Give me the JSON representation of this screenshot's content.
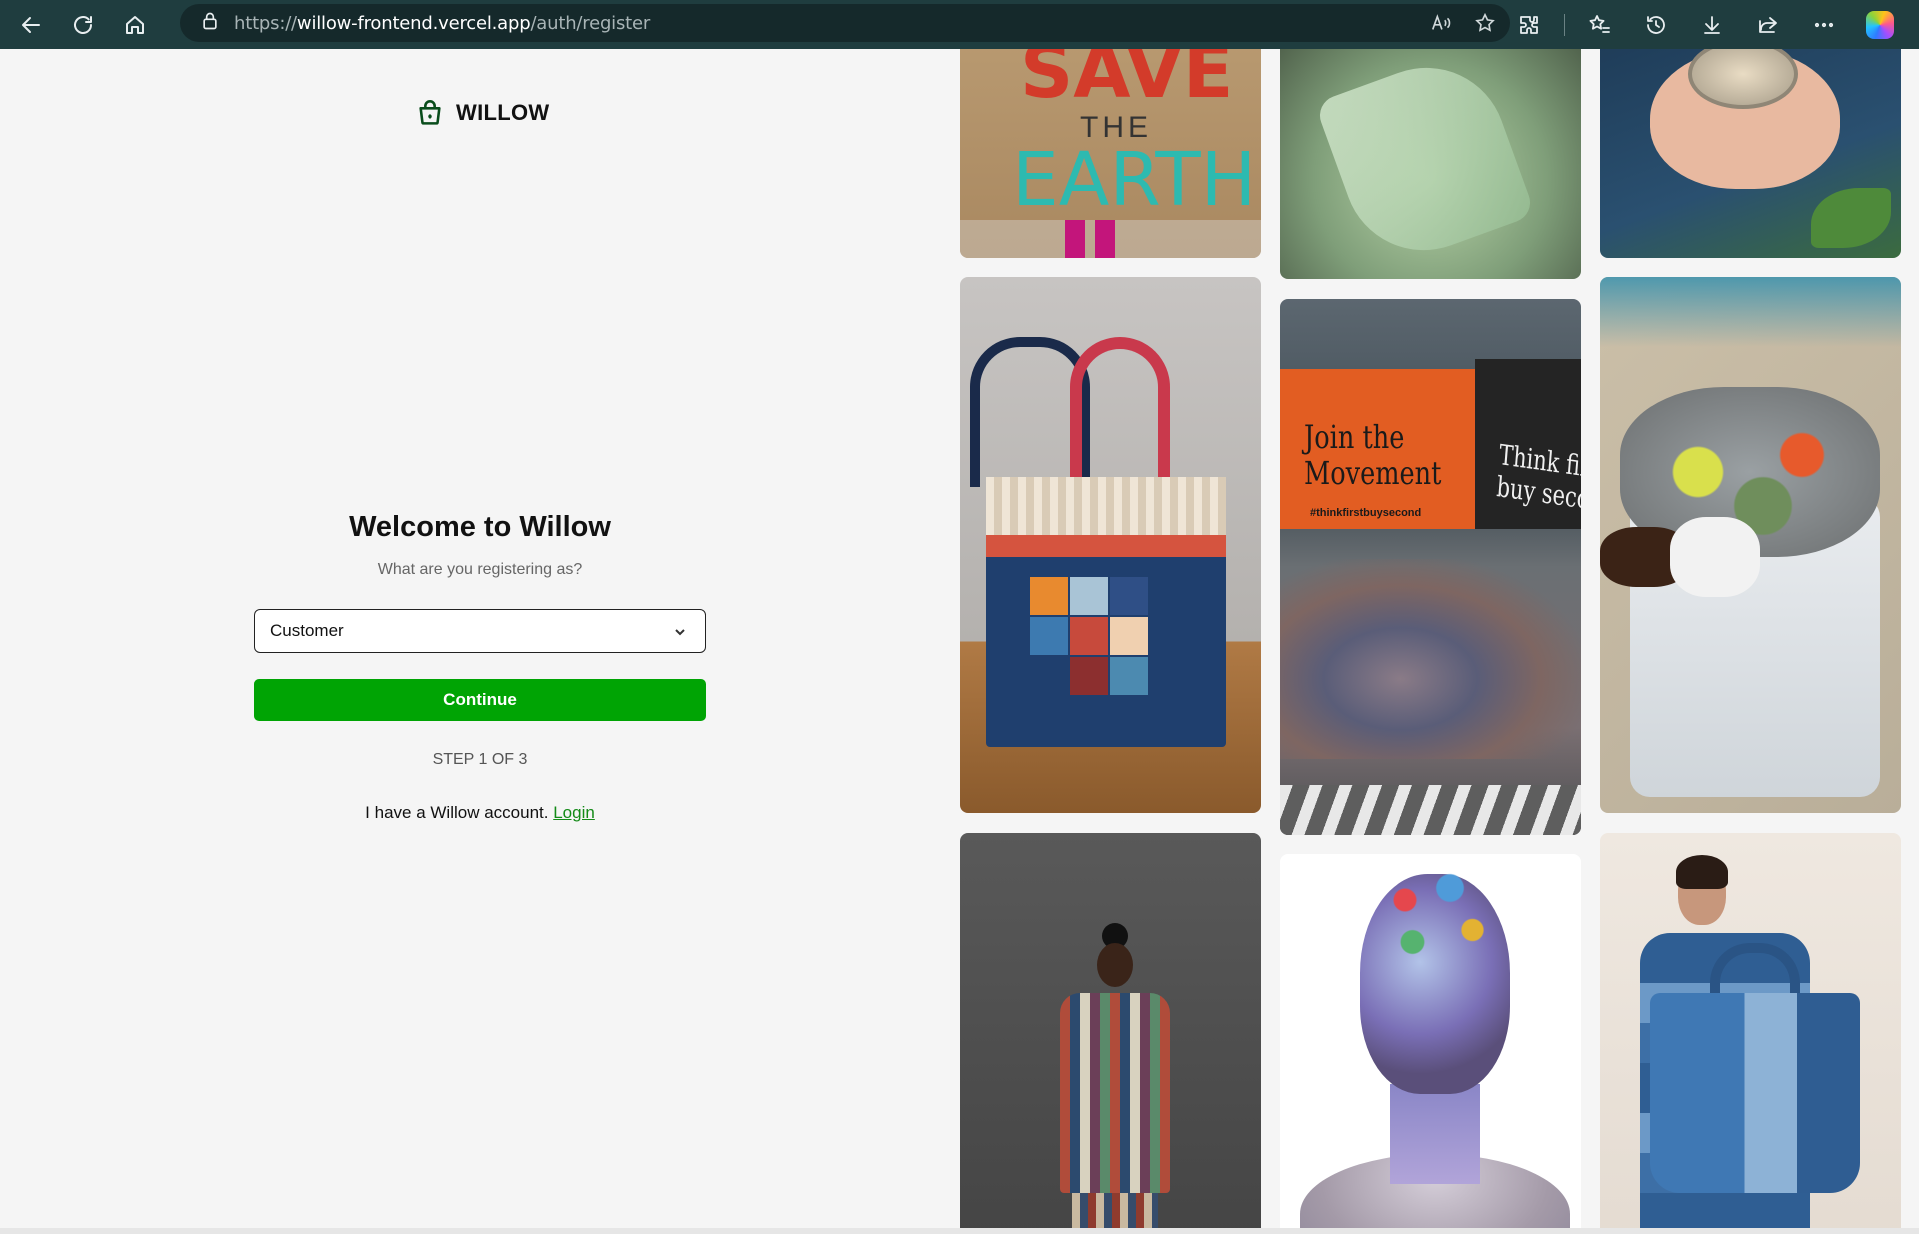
{
  "browser": {
    "url_scheme": "https://",
    "url_host": "willow-frontend.vercel.app",
    "url_path": "/auth/register"
  },
  "brand": {
    "name": "WILLOW",
    "icon": "shopping-basket-icon",
    "accent_color": "#00a404"
  },
  "register": {
    "title": "Welcome to Willow",
    "subtitle": "What are you registering as?",
    "role_select": {
      "selected": "Customer"
    },
    "continue_label": "Continue",
    "step_text": "STEP 1 OF 3",
    "account_prompt": "I have a Willow account.",
    "login_label": "Login"
  },
  "gallery": {
    "tiles": [
      {
        "name": "save-the-earth-sign",
        "text_lines": [
          "SAVE",
          "THE",
          "EARTH"
        ]
      },
      {
        "name": "green-mesh-bag"
      },
      {
        "name": "hands-holding-tin"
      },
      {
        "name": "patchwork-tote-bag"
      },
      {
        "name": "join-the-movement-billboard",
        "text_lines": [
          "Join the",
          "Movement",
          "#thinkfirstbuysecond",
          "Think first,",
          "buy second"
        ]
      },
      {
        "name": "plastic-waste-collection"
      },
      {
        "name": "patchwork-outfit-model"
      },
      {
        "name": "recycled-materials-sculpture"
      },
      {
        "name": "denim-patchwork-model"
      }
    ]
  }
}
